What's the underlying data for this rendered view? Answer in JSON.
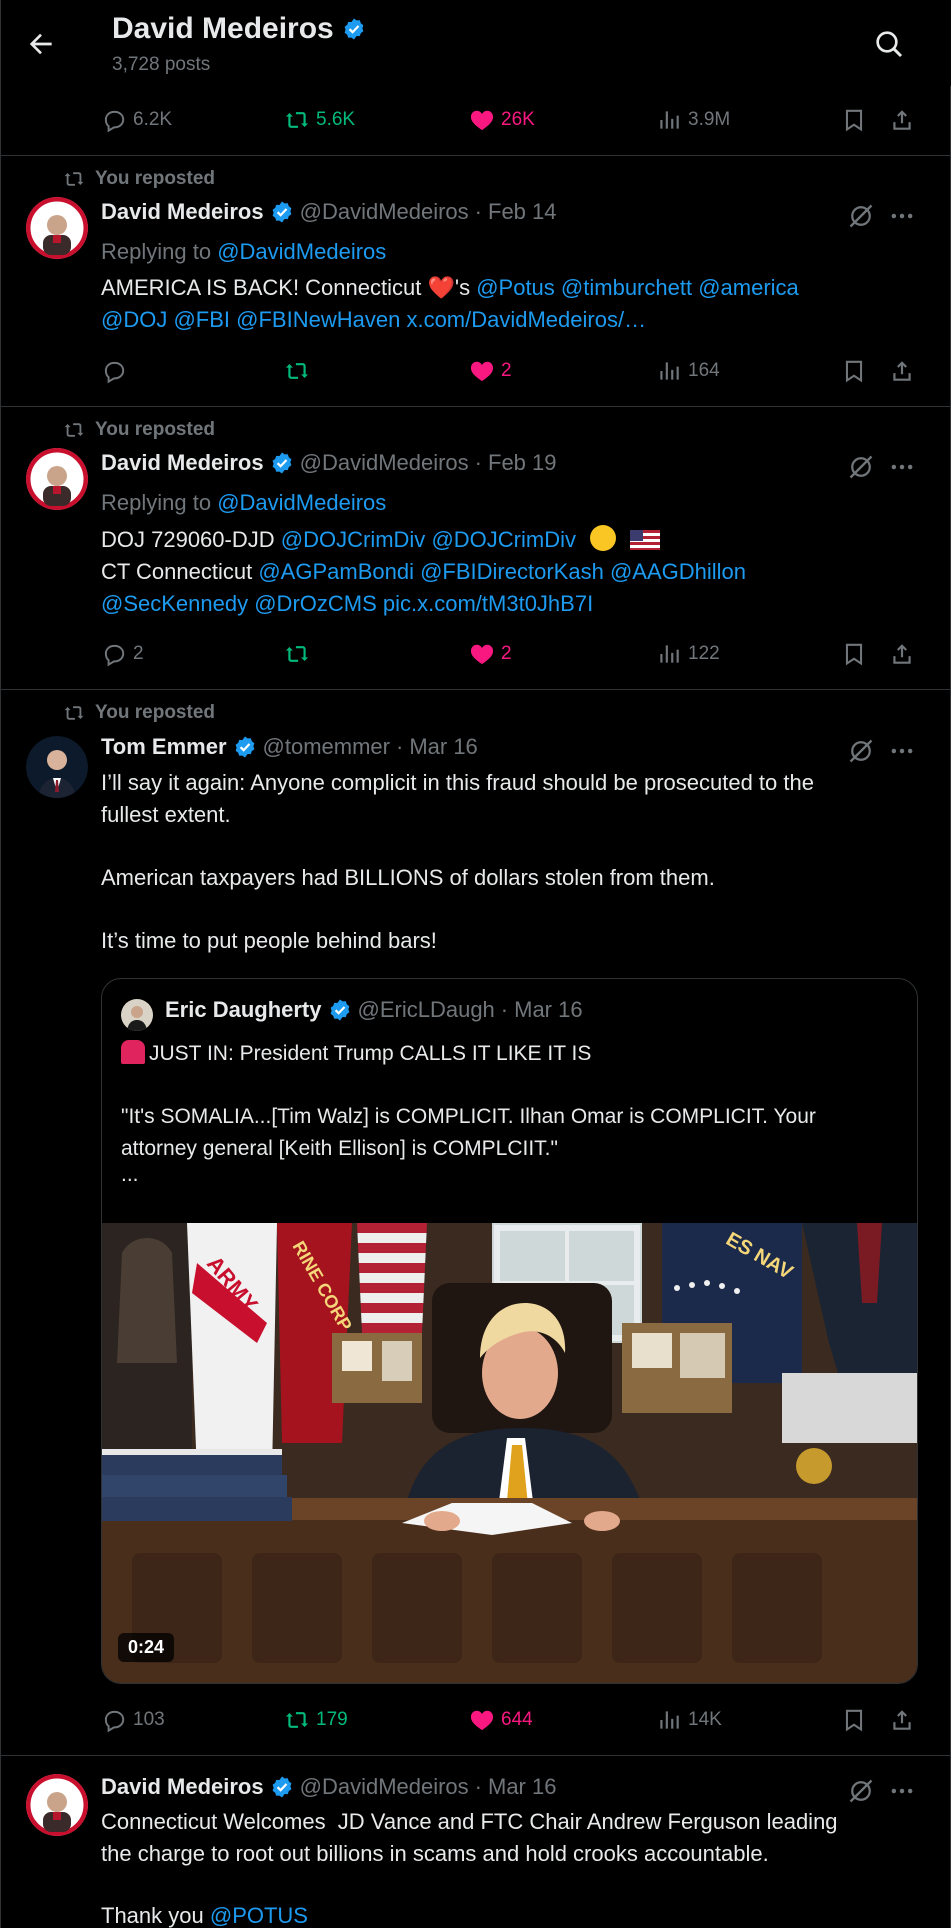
{
  "header": {
    "title": "David Medeiros",
    "posts_count": "3,728 posts"
  },
  "top_actions": {
    "replies": "6.2K",
    "reposts": "5.6K",
    "likes": "26K",
    "views": "3.9M"
  },
  "repost_label": "You reposted",
  "post1": {
    "name": "David Medeiros",
    "handle": "@DavidMedeiros",
    "date": "Feb 14",
    "replying_prefix": "Replying to",
    "replying_to": "@DavidMedeiros",
    "text_a": "AMERICA IS BACK! Connecticut",
    "text_b": "'s",
    "mentions_line1": [
      "@Potus",
      "@timburchett",
      "@america"
    ],
    "line2": [
      "@DOJ",
      "@FBI",
      "@FBINewHaven",
      "x.com/DavidMedeiros/…"
    ],
    "actions": {
      "replies": "",
      "reposts": "",
      "likes": "2",
      "views": "164"
    }
  },
  "post2": {
    "name": "David Medeiros",
    "handle": "@DavidMedeiros",
    "date": "Feb 19",
    "replying_prefix": "Replying to",
    "replying_to": "@DavidMedeiros",
    "line1_text": "DOJ 729060-DJD",
    "line1_links": [
      "@DOJCrimDiv",
      "@DOJCrimDiv"
    ],
    "line2_text": "CT Connecticut",
    "line2_links": [
      "@AGPamBondi",
      "@FBIDirectorKash",
      "@AAGDhillon"
    ],
    "line3_links": [
      "@SecKennedy",
      "@DrOzCMS",
      "pic.x.com/tM3t0JhB7I"
    ],
    "actions": {
      "replies": "2",
      "reposts": "",
      "likes": "2",
      "views": "122"
    }
  },
  "post3": {
    "name": "Tom Emmer",
    "handle": "@tomemmer",
    "date": "Mar 16",
    "lines": [
      "I’ll say it again: Anyone complicit in this fraud should be prosecuted to the",
      "fullest extent.",
      "American taxpayers had BILLIONS of dollars stolen from them.",
      "It’s time to put people behind bars!"
    ],
    "quote": {
      "name": "Eric Daugherty",
      "handle": "@EricLDaugh",
      "date": "Mar 16",
      "line1": "JUST IN: President Trump CALLS IT LIKE IT IS",
      "line2": "\"It's SOMALIA...[Tim Walz] is COMPLICIT. Ilhan Omar is COMPLICIT. Your",
      "line3": "attorney general [Keith Ellison] is COMPLCIIT.\"",
      "line4": "...",
      "flag_army": "ARMY",
      "flag_marine": "RINE CORP",
      "flag_navy": "ES NAV",
      "duration": "0:24"
    },
    "actions": {
      "replies": "103",
      "reposts": "179",
      "likes": "644",
      "views": "14K"
    }
  },
  "post4": {
    "name": "David Medeiros",
    "handle": "@DavidMedeiros",
    "date": "Mar 16",
    "line1": "Connecticut Welcomes  JD Vance and FTC Chair Andrew Ferguson leading",
    "line2": "the charge to root out billions in scams and hold crooks accountable.",
    "line3_text": "Thank you",
    "line3_link": "@POTUS"
  },
  "colors": {
    "accent": "#1d9bf0",
    "repost_green": "#00ba7c",
    "like_pink": "#f91880",
    "muted": "#71767b"
  }
}
